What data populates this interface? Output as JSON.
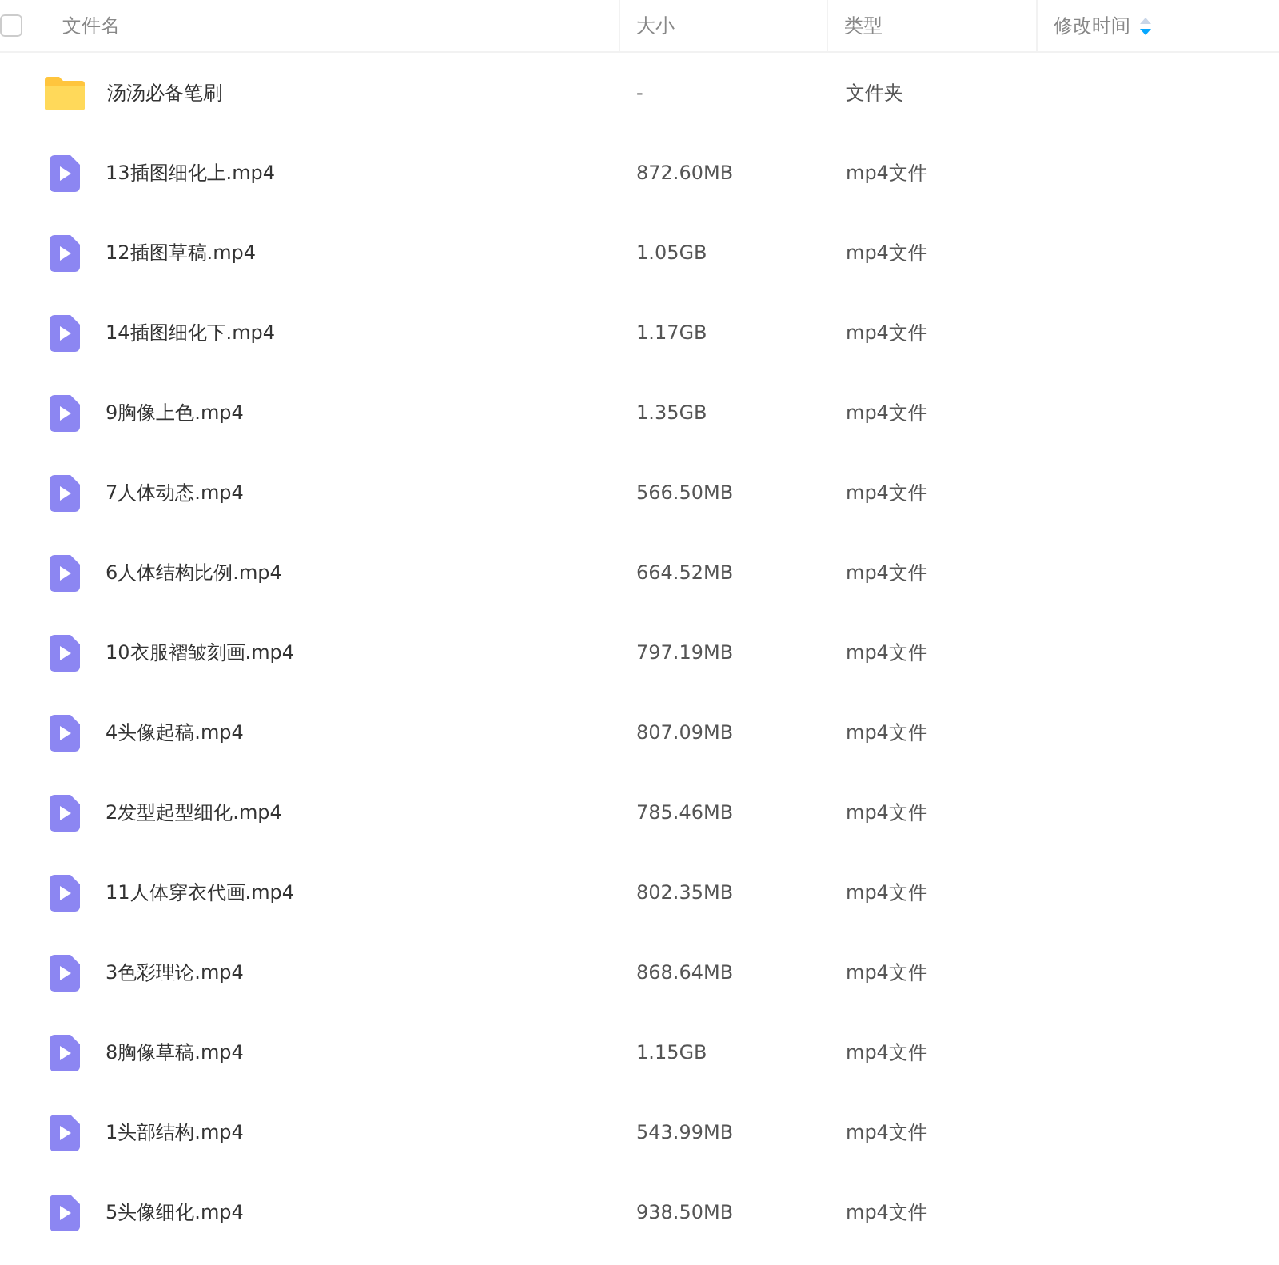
{
  "table": {
    "select_all": {
      "checked": false
    },
    "columns": [
      {
        "label": "文件名",
        "sorted": false
      },
      {
        "label": "大小",
        "sorted": false
      },
      {
        "label": "类型",
        "sorted": false
      },
      {
        "label": "修改时间",
        "sorted": true
      }
    ],
    "rows": [
      {
        "kind": "folder",
        "name": "汤汤必备笔刷",
        "size": "-",
        "type": "文件夹"
      },
      {
        "kind": "video",
        "name": "13插图细化上.mp4",
        "size": "872.60MB",
        "type": "mp4文件"
      },
      {
        "kind": "video",
        "name": "12插图草稿.mp4",
        "size": "1.05GB",
        "type": "mp4文件"
      },
      {
        "kind": "video",
        "name": "14插图细化下.mp4",
        "size": "1.17GB",
        "type": "mp4文件"
      },
      {
        "kind": "video",
        "name": "9胸像上色.mp4",
        "size": "1.35GB",
        "type": "mp4文件"
      },
      {
        "kind": "video",
        "name": "7人体动态.mp4",
        "size": "566.50MB",
        "type": "mp4文件"
      },
      {
        "kind": "video",
        "name": "6人体结构比例.mp4",
        "size": "664.52MB",
        "type": "mp4文件"
      },
      {
        "kind": "video",
        "name": "10衣服褶皱刻画.mp4",
        "size": "797.19MB",
        "type": "mp4文件"
      },
      {
        "kind": "video",
        "name": "4头像起稿.mp4",
        "size": "807.09MB",
        "type": "mp4文件"
      },
      {
        "kind": "video",
        "name": "2发型起型细化.mp4",
        "size": "785.46MB",
        "type": "mp4文件"
      },
      {
        "kind": "video",
        "name": "11人体穿衣代画.mp4",
        "size": "802.35MB",
        "type": "mp4文件"
      },
      {
        "kind": "video",
        "name": "3色彩理论.mp4",
        "size": "868.64MB",
        "type": "mp4文件"
      },
      {
        "kind": "video",
        "name": "8胸像草稿.mp4",
        "size": "1.15GB",
        "type": "mp4文件"
      },
      {
        "kind": "video",
        "name": "1头部结构.mp4",
        "size": "543.99MB",
        "type": "mp4文件"
      },
      {
        "kind": "video",
        "name": "5头像细化.mp4",
        "size": "938.50MB",
        "type": "mp4文件"
      }
    ]
  }
}
